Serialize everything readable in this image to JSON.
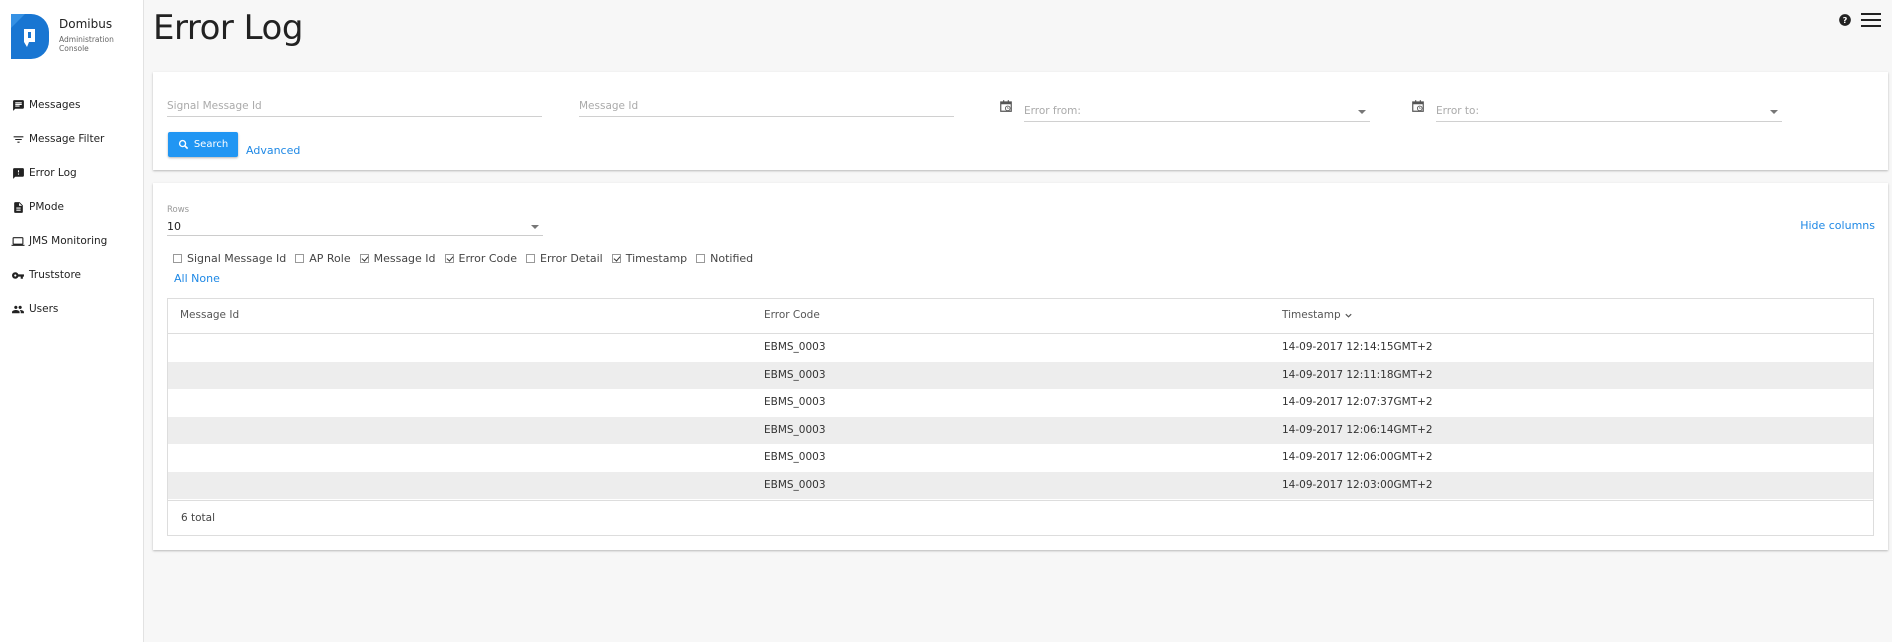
{
  "brand": {
    "name": "Domibus",
    "subtitle_line1": "Administration",
    "subtitle_line2": "Console"
  },
  "nav": [
    {
      "label": "Messages",
      "icon": "message-icon"
    },
    {
      "label": "Message Filter",
      "icon": "filter-icon"
    },
    {
      "label": "Error Log",
      "icon": "alert-icon"
    },
    {
      "label": "PMode",
      "icon": "document-icon"
    },
    {
      "label": "JMS Monitoring",
      "icon": "laptop-icon"
    },
    {
      "label": "Truststore",
      "icon": "key-icon"
    },
    {
      "label": "Users",
      "icon": "users-icon"
    }
  ],
  "page": {
    "title": "Error Log"
  },
  "filters": {
    "signal_message_id_placeholder": "Signal Message Id",
    "message_id_placeholder": "Message Id",
    "error_from_placeholder": "Error from:",
    "error_to_placeholder": "Error to:",
    "search_label": "Search",
    "advanced_label": "Advanced"
  },
  "results": {
    "rows_label": "Rows",
    "rows_value": "10",
    "hide_columns_label": "Hide columns",
    "column_toggles": [
      {
        "label": "Signal Message Id",
        "checked": false
      },
      {
        "label": "AP Role",
        "checked": false
      },
      {
        "label": "Message Id",
        "checked": true
      },
      {
        "label": "Error Code",
        "checked": true
      },
      {
        "label": "Error Detail",
        "checked": false
      },
      {
        "label": "Timestamp",
        "checked": true
      },
      {
        "label": "Notified",
        "checked": false
      }
    ],
    "all_label": "All",
    "none_label": "None",
    "headers": {
      "message_id": "Message Id",
      "error_code": "Error Code",
      "timestamp": "Timestamp"
    },
    "rows": [
      {
        "message_id": "",
        "error_code": "EBMS_0003",
        "timestamp": "14-09-2017 12:14:15GMT+2"
      },
      {
        "message_id": "",
        "error_code": "EBMS_0003",
        "timestamp": "14-09-2017 12:11:18GMT+2"
      },
      {
        "message_id": "",
        "error_code": "EBMS_0003",
        "timestamp": "14-09-2017 12:07:37GMT+2"
      },
      {
        "message_id": "",
        "error_code": "EBMS_0003",
        "timestamp": "14-09-2017 12:06:14GMT+2"
      },
      {
        "message_id": "",
        "error_code": "EBMS_0003",
        "timestamp": "14-09-2017 12:06:00GMT+2"
      },
      {
        "message_id": "",
        "error_code": "EBMS_0003",
        "timestamp": "14-09-2017 12:03:00GMT+2"
      }
    ],
    "total_label": "6 total"
  },
  "colors": {
    "accent": "#2196f3",
    "link": "#1e88e5",
    "logo": "#1976d2"
  }
}
